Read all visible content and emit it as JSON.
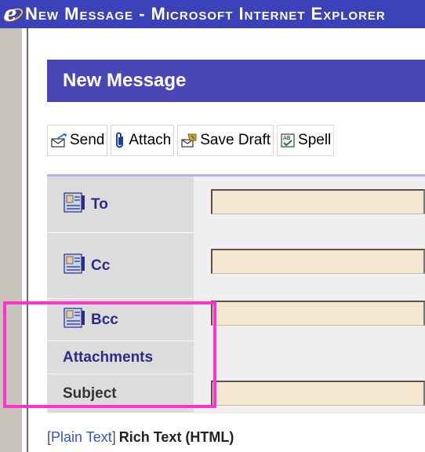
{
  "window": {
    "title": "New Message - Microsoft Internet Explorer"
  },
  "header": {
    "title": "New Message"
  },
  "toolbar": {
    "send_label": "Send",
    "attach_label": "Attach",
    "save_draft_label": "Save Draft",
    "spell_label": "Spell"
  },
  "fields": {
    "to_label": "To",
    "to_value": "",
    "cc_label": "Cc",
    "cc_value": "",
    "bcc_label": "Bcc",
    "bcc_value": "",
    "attachments_label": "Attachments",
    "subject_label": "Subject",
    "subject_value": ""
  },
  "format": {
    "bracket_open": "[",
    "plain_text": "Plain Text",
    "bracket_close": "]",
    "rich_text": "Rich Text (HTML)"
  },
  "colors": {
    "title_bar": "#3b41b8",
    "header": "#4a46b8",
    "label_text": "#2b2b8c",
    "field_bg": "#f3e8cf",
    "highlight": "#ff33cc",
    "link": "#3355cc"
  }
}
